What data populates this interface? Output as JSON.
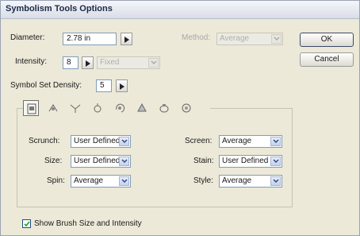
{
  "window": {
    "title": "Symbolism Tools Options"
  },
  "diameter": {
    "label": "Diameter:",
    "value": "2.78 in"
  },
  "method": {
    "label": "Method:",
    "value": "Average"
  },
  "intensity": {
    "label": "Intensity:",
    "value": "8",
    "mode": "Fixed"
  },
  "density": {
    "label": "Symbol Set Density:",
    "value": "5"
  },
  "buttons": {
    "ok": "OK",
    "cancel": "Cancel"
  },
  "tools": [
    {
      "icon": "symbol-sprayer-icon",
      "selected": true
    },
    {
      "icon": "symbol-shifter-icon"
    },
    {
      "icon": "symbol-scruncher-icon"
    },
    {
      "icon": "symbol-sizer-icon"
    },
    {
      "icon": "symbol-spinner-icon"
    },
    {
      "icon": "symbol-stainer-icon"
    },
    {
      "icon": "symbol-screener-icon"
    },
    {
      "icon": "symbol-styler-icon"
    }
  ],
  "options": {
    "scrunch": {
      "label": "Scrunch:",
      "value": "User Defined"
    },
    "size": {
      "label": "Size:",
      "value": "User Defined"
    },
    "spin": {
      "label": "Spin:",
      "value": "Average"
    },
    "screen": {
      "label": "Screen:",
      "value": "Average"
    },
    "stain": {
      "label": "Stain:",
      "value": "User Defined"
    },
    "style": {
      "label": "Style:",
      "value": "Average"
    }
  },
  "show_brush": {
    "label": "Show Brush Size and Intensity",
    "checked": true
  },
  "colors": {
    "title_text": "#1d2a44",
    "panel_bg": "#ece9d8",
    "field_border": "#7f9db9"
  }
}
